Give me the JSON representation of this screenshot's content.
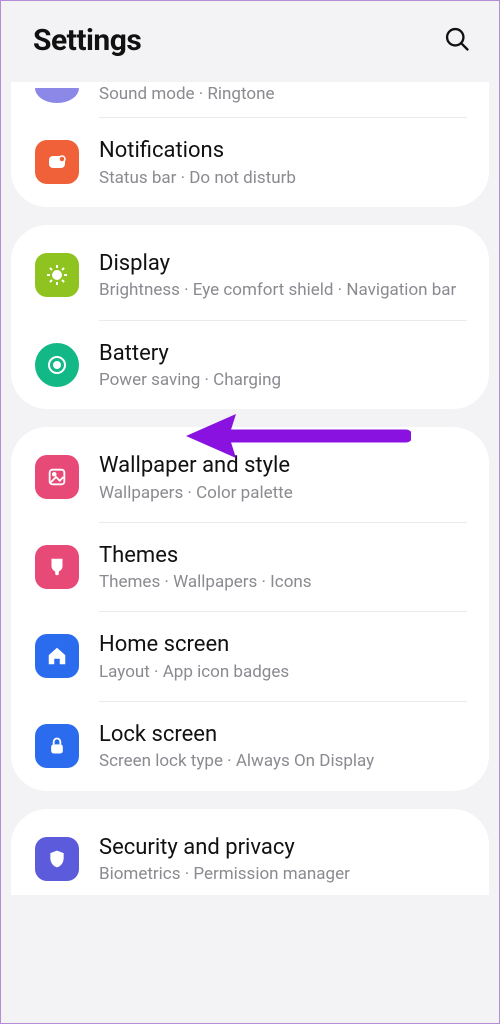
{
  "header": {
    "title": "Settings"
  },
  "groups": [
    {
      "items": [
        {
          "key": "sounds",
          "title": "",
          "sub": "Sound mode  ·  Ringtone"
        },
        {
          "key": "notifications",
          "title": "Notifications",
          "sub": "Status bar  ·  Do not disturb"
        }
      ]
    },
    {
      "items": [
        {
          "key": "display",
          "title": "Display",
          "sub": "Brightness  ·  Eye comfort shield  ·  Navigation bar"
        },
        {
          "key": "battery",
          "title": "Battery",
          "sub": "Power saving  ·  Charging"
        }
      ]
    },
    {
      "items": [
        {
          "key": "wallpaper",
          "title": "Wallpaper and style",
          "sub": "Wallpapers  ·  Color palette"
        },
        {
          "key": "themes",
          "title": "Themes",
          "sub": "Themes  ·  Wallpapers  ·  Icons"
        },
        {
          "key": "homescreen",
          "title": "Home screen",
          "sub": "Layout  ·  App icon badges"
        },
        {
          "key": "lockscreen",
          "title": "Lock screen",
          "sub": "Screen lock type  ·  Always On Display"
        }
      ]
    },
    {
      "items": [
        {
          "key": "security",
          "title": "Security and privacy",
          "sub": "Biometrics  ·  Permission manager"
        }
      ]
    }
  ],
  "icon_colors": {
    "notifications": "#f0613a",
    "display": "#8fc31f",
    "battery": "#12b886",
    "wallpaper": "#e84a78",
    "themes": "#e84a78",
    "homescreen": "#2b6bed",
    "lockscreen": "#2b6bed",
    "security": "#5b5bdb"
  },
  "annotation": {
    "arrow_target": "battery",
    "color": "#8a12e0"
  }
}
